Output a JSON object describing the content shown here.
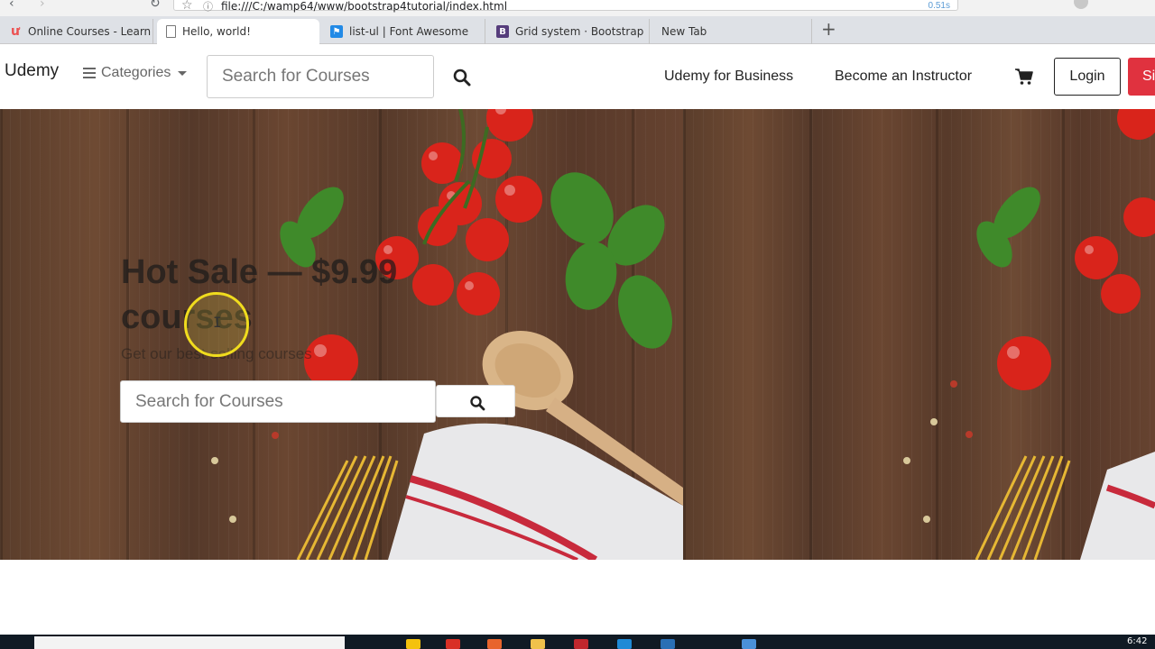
{
  "browser": {
    "url": "file:///C:/wamp64/www/bootstrap4tutorial/index.html",
    "load_time": "0.51s",
    "tabs": [
      {
        "title": "Online Courses - Learn Any",
        "favicon": "udemy-icon",
        "active": false
      },
      {
        "title": "Hello, world!",
        "favicon": "document-icon",
        "active": true
      },
      {
        "title": "list-ul | Font Awesome",
        "favicon": "font-awesome-icon",
        "active": false
      },
      {
        "title": "Grid system · Bootstrap",
        "favicon": "bootstrap-icon",
        "active": false
      },
      {
        "title": "New Tab",
        "favicon": "",
        "active": false
      }
    ],
    "bootstrap_favicon_letter": "B"
  },
  "navbar": {
    "brand": "Udemy",
    "categories_label": "Categories",
    "search_placeholder": "Search for Courses",
    "links": [
      "Udemy for Business",
      "Become an Instructor"
    ],
    "login_label": "Login",
    "signup_label": "Si"
  },
  "hero": {
    "title": "Hot Sale — $9.99 courses",
    "subtitle": "Get our best-selling courses",
    "search_placeholder": "Search for Courses"
  },
  "taskbar": {
    "clock": "6:42"
  },
  "colors": {
    "brand_red": "#e0323f",
    "tab_strip": "#dee1e6",
    "wood": "#5a3d2b",
    "cursor_highlight": "#f0dc1e"
  }
}
